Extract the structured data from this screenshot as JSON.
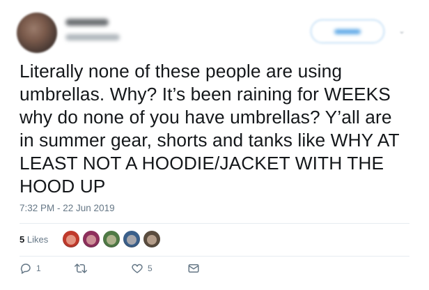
{
  "tweet": {
    "text_lines": [
      "Literally none of these people are using",
      "umbrellas. Why? It’s been raining for WEEKS",
      "why do none of you have umbrellas? Y’all are",
      "in summer gear, shorts and tanks like WHY AT",
      "LEAST NOT A HOODIE/JACKET WITH THE",
      "HOOD UP"
    ],
    "timestamp": "7:32 PM - 22 Jun 2019"
  },
  "stats": {
    "likes_count": "5",
    "likes_label": "Likes",
    "liker_avatar_colors": [
      "#c0392b",
      "#8e2f5c",
      "#4f7a45",
      "#3a5f8a",
      "#5a4c3e"
    ]
  },
  "actions": {
    "reply_count": "1",
    "retweet_count": "",
    "like_count": "5",
    "icons": [
      "reply-icon",
      "retweet-icon",
      "heart-icon",
      "message-icon"
    ]
  },
  "colors": {
    "text": "#14171a",
    "muted": "#657786",
    "divider": "#e6ecf0",
    "accent": "#1da1f2"
  }
}
